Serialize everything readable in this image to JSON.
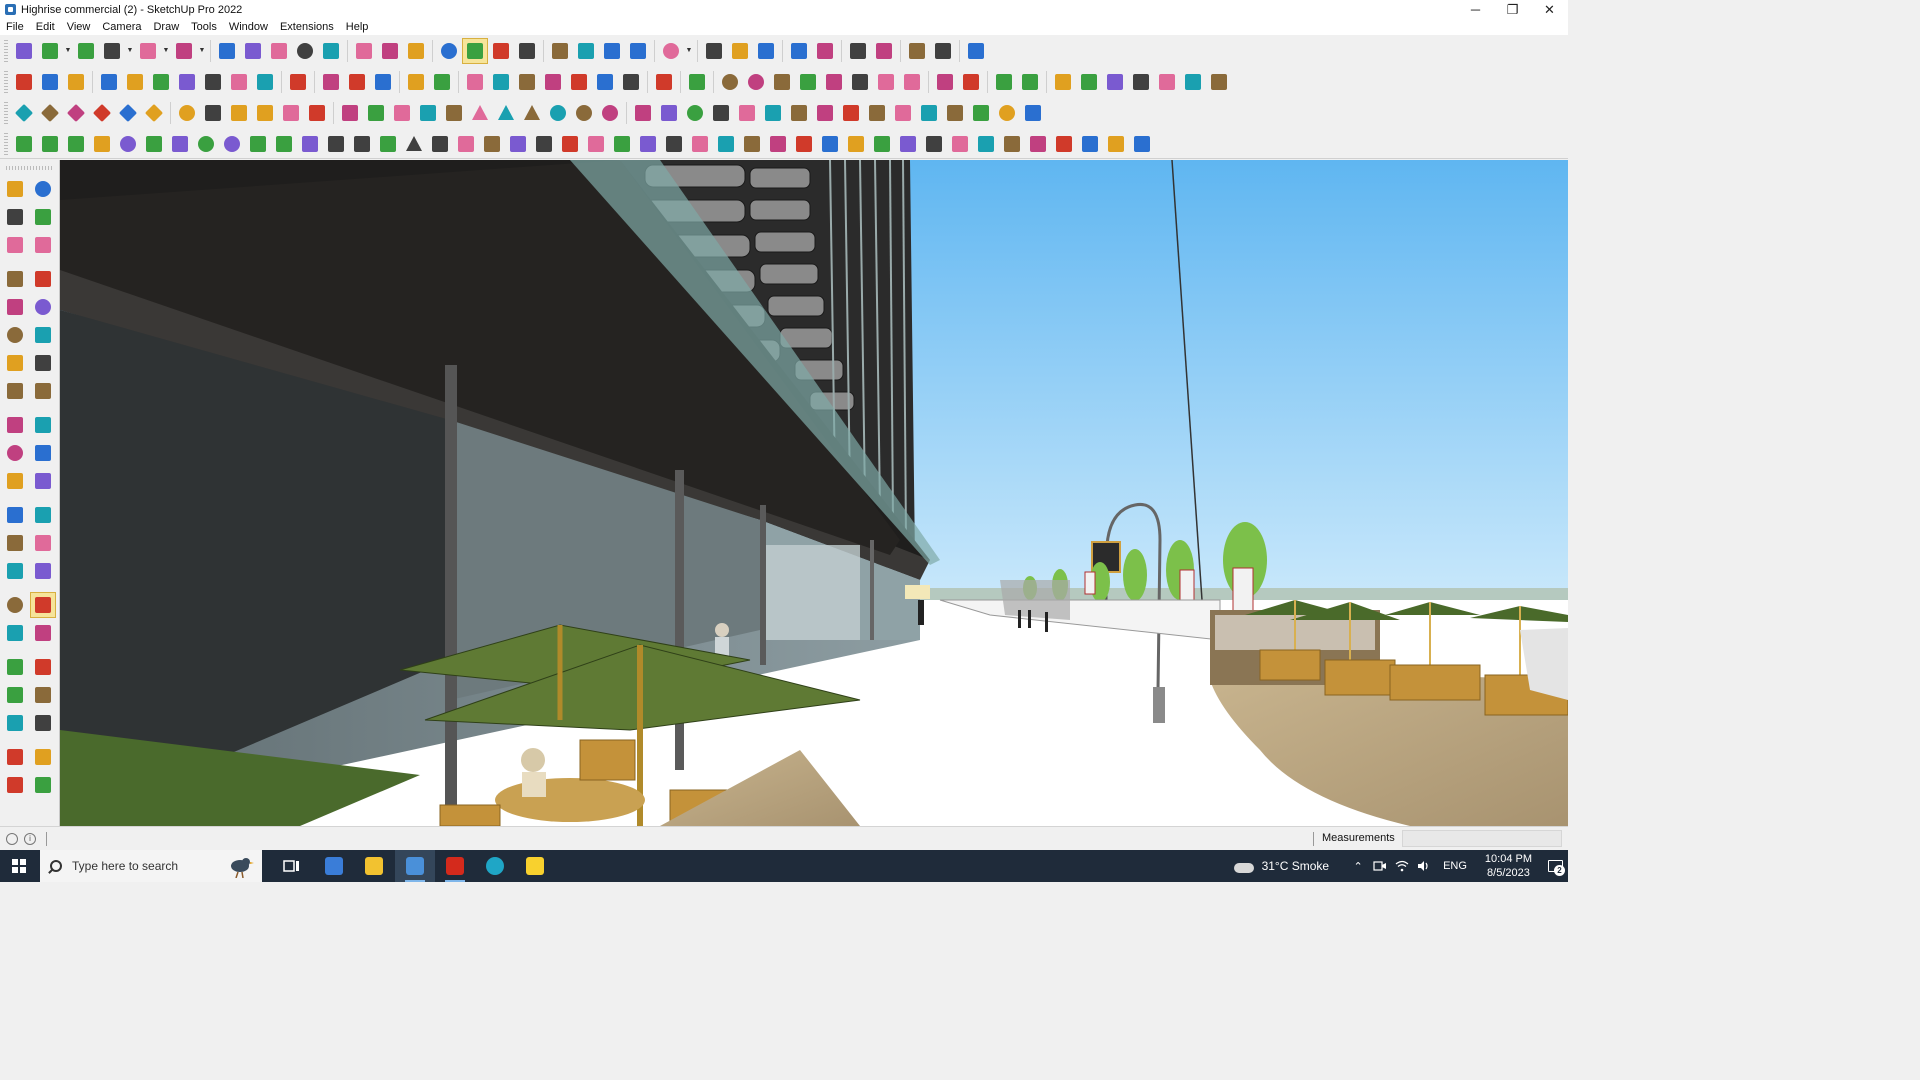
{
  "window": {
    "title": "Highrise commercial (2) - SketchUp Pro 2022",
    "minimize_glyph": "─",
    "restore_glyph": "❐",
    "close_glyph": "✕"
  },
  "menu": [
    "File",
    "Edit",
    "View",
    "Camera",
    "Draw",
    "Tools",
    "Window",
    "Extensions",
    "Help"
  ],
  "toolbar_rows": [
    [
      "search-icon",
      "select-icon",
      "#dropdown",
      "eraser-icon",
      "pencil-icon",
      "#dropdown",
      "lasso-icon",
      "#dropdown",
      "rectangle-icon",
      "#dropdown",
      "#sep",
      "push-pull-icon",
      "follow-me-icon",
      "move-icon",
      "rotate-icon",
      "scale-icon",
      "#sep",
      "tape-measure-icon",
      "text-icon",
      "paint-bucket-icon",
      "#sep",
      "orbit-icon",
      "pan-icon",
      "zoom-icon",
      "zoom-extents-icon",
      "#sep",
      "components-icon",
      "layers-icon",
      "tags-icon",
      "styles-icon",
      "#sep",
      "user-icon",
      "#dropdown",
      "#sep",
      "warehouse-icon",
      "extension-icon",
      "section-icon",
      "#sep",
      "up-arrow-icon",
      "down-arrow-icon",
      "#sep",
      "dimension-icon",
      "3d-text-icon",
      "#sep",
      "undo-icon",
      "redo-icon",
      "#sep",
      "report-icon"
    ],
    [
      "box-icon",
      "box-icon",
      "box-icon",
      "#sep",
      "push-pull-icon",
      "push-pull-icon",
      "push-pull-icon",
      "push-pull-icon",
      "push-pull-icon",
      "push-pull-icon",
      "push-pull-icon",
      "#sep",
      "curve-icon",
      "#sep",
      "section-plane-icon",
      "section-plane-icon",
      "section-plane-icon",
      "#sep",
      "face-icon",
      "face-icon",
      "#sep",
      "house-icon",
      "house-icon",
      "house-icon",
      "house-icon",
      "house-icon",
      "house-icon",
      "text-icon",
      "#sep",
      "leaf-icon",
      "#sep",
      "knife-icon",
      "#sep",
      "circle-icon",
      "circle-icon",
      "polygon-icon",
      "ellipse-icon",
      "parallelogram-icon",
      "arc-icon",
      "arc-icon",
      "pen-icon",
      "#sep",
      "lasso-icon",
      "lasso-icon",
      "#sep",
      "stretch-icon",
      "eraser-icon",
      "#sep",
      "shape-icon",
      "shape-icon",
      "shape-icon",
      "shape-icon",
      "shape-icon",
      "shape-icon",
      "shape-icon"
    ],
    [
      "solid-icon",
      "solid-icon",
      "solid-icon",
      "solid-icon",
      "solid-icon",
      "solid-icon",
      "#sep",
      "rotate-icon",
      "square-icon",
      "lines-icon",
      "panel-icon",
      "wood-icon",
      "joint-icon",
      "#sep",
      "curve-icon",
      "dots-icon",
      "cross-icon",
      "cross-icon",
      "cross-icon",
      "cone-icon",
      "cone-icon",
      "cone-icon",
      "spiral-icon",
      "spiral-icon",
      "spiral-icon",
      "#sep",
      "axis-icon",
      "box-icon",
      "rotate-icon",
      "stack-icon",
      "stack-icon",
      "stack-icon",
      "stack-icon",
      "stack-icon",
      "stack-icon",
      "frame-icon",
      "grid-icon",
      "grid-icon",
      "grid-icon",
      "x-icon",
      "circle-icon",
      "grid-icon"
    ],
    [
      "tool-icon",
      "curve-icon",
      "paint-icon",
      "cut-icon",
      "gear-icon",
      "shape-icon",
      "spring-icon",
      "sphere-icon",
      "sphere-icon",
      "wave-icon",
      "line-icon",
      "line-icon",
      "line-icon",
      "curve-icon",
      "rail-icon",
      "stair-icon",
      "bars-icon",
      "bars-icon",
      "hand-icon",
      "leaf-icon",
      "leaf-icon",
      "bars-icon",
      "wave-icon",
      "fence-icon",
      "fence-icon",
      "fence-icon",
      "fence-icon",
      "fence-icon",
      "fence-icon",
      "fence-icon",
      "fence-icon",
      "fence-icon",
      "fence-icon",
      "fence-icon",
      "fence-icon",
      "fence-icon",
      "fence-icon",
      "fence-icon",
      "fence-icon",
      "fence-icon",
      "fence-icon",
      "fence-icon",
      "fence-icon",
      "shape-icon"
    ]
  ],
  "left_tools": [
    [
      "select-icon",
      "orbit-icon"
    ],
    [
      "paint-bucket-icon",
      "eraser-icon"
    ],
    [
      "components-icon",
      "pencil-icon"
    ],
    [
      "line-icon",
      "freehand-icon"
    ],
    [
      "rectangle-icon",
      "rotated-rectangle-icon"
    ],
    [
      "circle-icon",
      "polygon-icon"
    ],
    [
      "arc-icon",
      "arc2-icon"
    ],
    [
      "pie-icon",
      "arc3-icon"
    ],
    [
      "move-icon",
      "push-pull-icon"
    ],
    [
      "rotate-icon",
      "follow-me-icon"
    ],
    [
      "scale-icon",
      "offset-icon"
    ],
    [
      "tape-measure-icon",
      "dimension-icon"
    ],
    [
      "protractor-icon",
      "text-icon"
    ],
    [
      "axes-icon",
      "3d-text-icon"
    ],
    [
      "orbit-icon",
      "pan-icon"
    ],
    [
      "zoom-icon",
      "zoom-window-icon"
    ],
    [
      "zoom-extents-icon",
      "previous-icon"
    ],
    [
      "position-camera-icon",
      "look-around-icon"
    ],
    [
      "walk-icon",
      "section-plane-icon"
    ],
    [
      "components-icon",
      "tags-icon"
    ],
    [
      "layers-icon",
      "styles-icon"
    ]
  ],
  "status": {
    "measurements_label": "Measurements",
    "measurements_value": "",
    "info_glyph": "i"
  },
  "taskbar": {
    "search_placeholder": "Type here to search",
    "weather": "31°C  Smoke",
    "language": "ENG",
    "time": "10:04 PM",
    "date": "8/5/2023",
    "notification_count": "2",
    "up_glyph": "⌃"
  },
  "colors": {
    "accent_active": "#f6e49a",
    "sky_top": "#6bbcf2",
    "sky_bottom": "#bfe3fa",
    "umbrella": "#5d7a34",
    "building": "#3a3a3a",
    "taskbar": "#1f2b3a"
  }
}
